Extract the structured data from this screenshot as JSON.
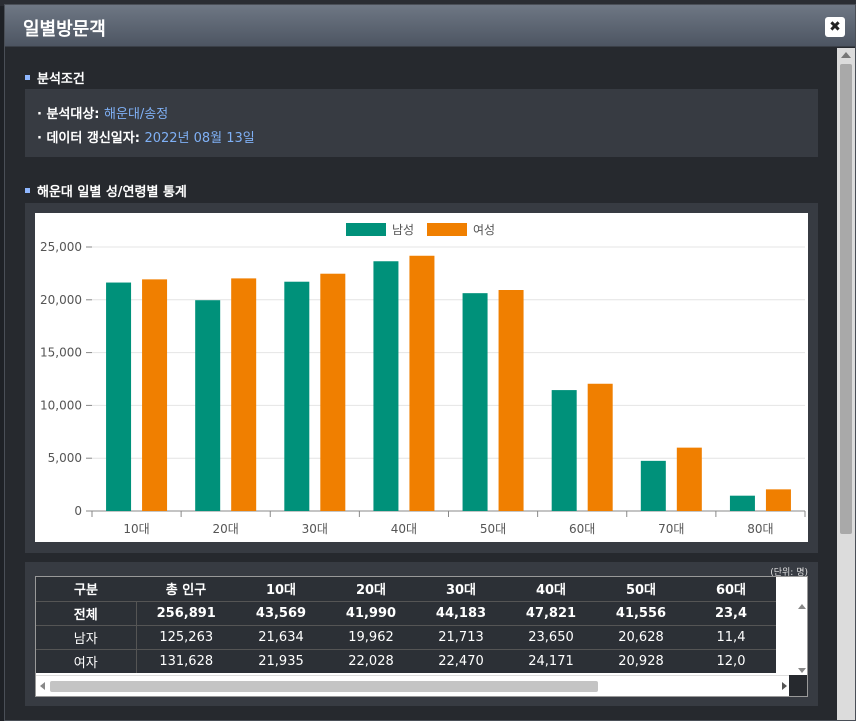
{
  "window": {
    "title": "일별방문객",
    "close_label": "✖"
  },
  "conditions": {
    "section_title": "분석조건",
    "target_label": "· 분석대상:",
    "target_value": "해운대/송정",
    "update_label": "· 데이터 갱신일자:",
    "update_value": "2022년 08월 13일"
  },
  "chart_section": {
    "title": "해운대 일별 성/연령별 통계"
  },
  "colors": {
    "male": "#00917a",
    "female": "#f07f00",
    "accent": "#7fb0f5"
  },
  "chart_data": {
    "type": "bar",
    "categories": [
      "10대",
      "20대",
      "30대",
      "40대",
      "50대",
      "60대",
      "70대",
      "80대"
    ],
    "series": [
      {
        "name": "남성",
        "values": [
          21634,
          19962,
          21713,
          23650,
          20628,
          11450,
          4750,
          1450
        ]
      },
      {
        "name": "여성",
        "values": [
          21935,
          22028,
          22470,
          24171,
          20928,
          12050,
          6000,
          2050
        ]
      }
    ],
    "ylim": [
      0,
      25000
    ],
    "yticks": [
      "0",
      "5,000",
      "10,000",
      "15,000",
      "20,000",
      "25,000"
    ],
    "grid": true,
    "legend": "top-center"
  },
  "table": {
    "unit": "(단위: 명)",
    "headers": [
      "구분",
      "총 인구",
      "10대",
      "20대",
      "30대",
      "40대",
      "50대",
      "60대"
    ],
    "rows": [
      {
        "cells": [
          "전체",
          "256,891",
          "43,569",
          "41,990",
          "44,183",
          "47,821",
          "41,556",
          "23,4"
        ]
      },
      {
        "cells": [
          "남자",
          "125,263",
          "21,634",
          "19,962",
          "21,713",
          "23,650",
          "20,628",
          "11,4"
        ]
      },
      {
        "cells": [
          "여자",
          "131,628",
          "21,935",
          "22,028",
          "22,470",
          "24,171",
          "20,928",
          "12,0"
        ]
      }
    ]
  }
}
